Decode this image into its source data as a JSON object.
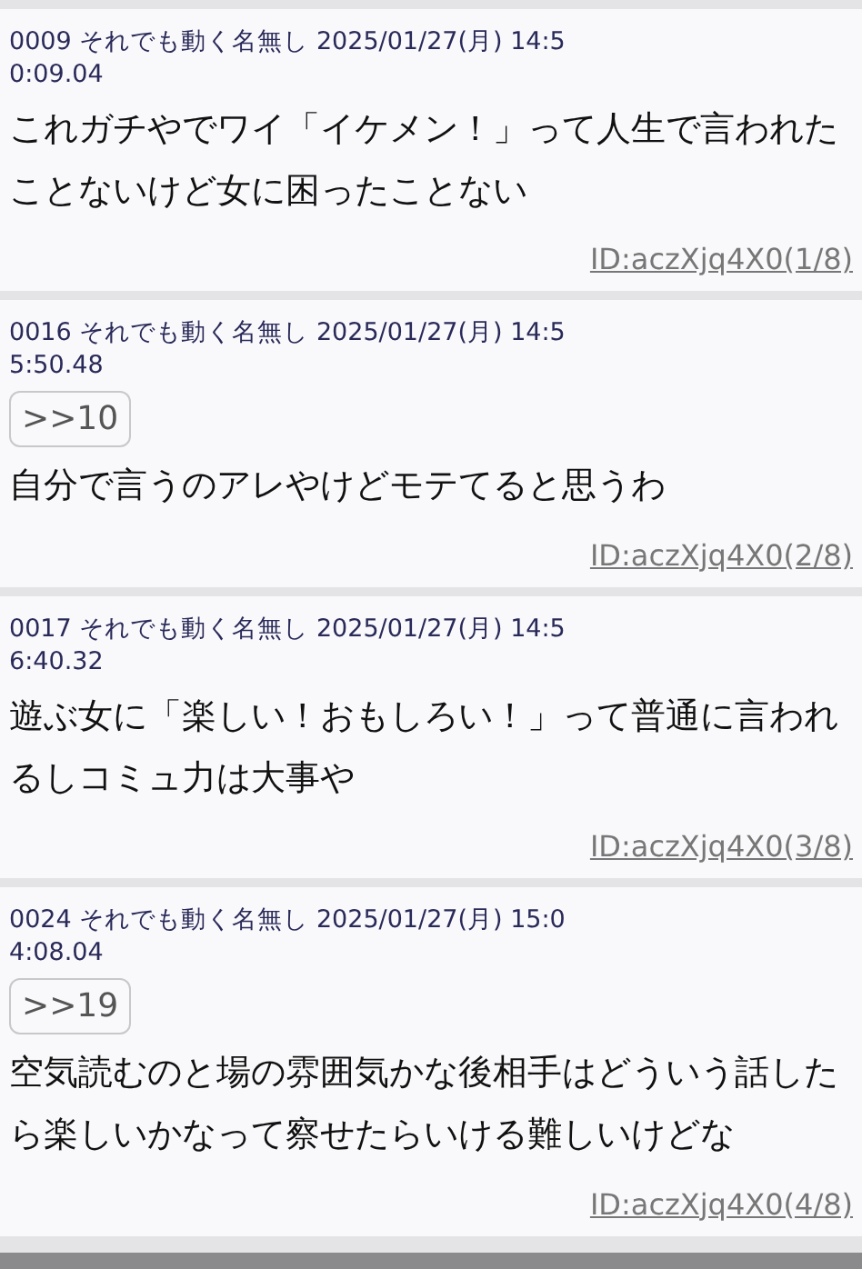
{
  "posts": [
    {
      "header": "0009 それでも動く名無し 2025/01/27(月) 14:50:09.04",
      "body": "これガチやでワイ「イケメン！」って人生で言われたことないけど女に困ったことない",
      "id_link": "ID:aczXjq4X0(1/8)"
    },
    {
      "header": "0016 それでも動く名無し 2025/01/27(月) 14:55:50.48",
      "quote": ">>10",
      "body": "自分で言うのアレやけどモテてると思うわ",
      "id_link": "ID:aczXjq4X0(2/8)"
    },
    {
      "header": "0017 それでも動く名無し 2025/01/27(月) 14:56:40.32",
      "body": "遊ぶ女に「楽しい！おもしろい！」って普通に言われるしコミュ力は大事や",
      "id_link": "ID:aczXjq4X0(3/8)"
    },
    {
      "header": "0024 それでも動く名無し 2025/01/27(月) 15:04:08.04",
      "quote": ">>19",
      "body": "空気読むのと場の雰囲気かな後相手はどういう話したら楽しいかなって察せたらいける難しいけどな",
      "id_link": "ID:aczXjq4X0(4/8)"
    }
  ]
}
